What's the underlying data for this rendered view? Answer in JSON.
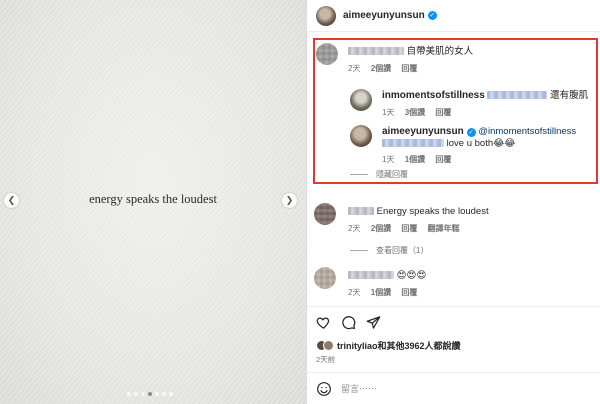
{
  "post": {
    "image_text": "energy speaks the loudest",
    "carousel": {
      "count": 7,
      "active_index": 3
    }
  },
  "header": {
    "username": "aimeeyunyunsun",
    "verified": true
  },
  "comments": [
    {
      "text": "自帶美肌的女人",
      "time": "2天",
      "likes": "2個讚",
      "reply": "回覆",
      "replies": [
        {
          "username": "inmomentsofstillness",
          "text": "還有腹肌",
          "time": "1天",
          "likes": "3個讚",
          "reply": "回覆"
        },
        {
          "username": "aimeeyunyunsun",
          "mention": "@inmomentsofstillness",
          "text": "love u both😂😂",
          "time": "1天",
          "likes": "1個讚",
          "reply": "回覆"
        }
      ],
      "toggle": "隱藏回覆"
    },
    {
      "text": "Energy speaks the loudest",
      "time": "2天",
      "likes": "2個讚",
      "reply": "回覆",
      "translate": "翻譯年糕",
      "toggle": "查看回覆（1）"
    },
    {
      "text": "😍😍😍",
      "time": "2天",
      "likes": "1個讚",
      "reply": "回覆"
    }
  ],
  "footer": {
    "liked_by": "trinityliao和其他3962人都說讚",
    "ago": "2天前",
    "comment_placeholder": "留言⋯⋯"
  },
  "colors": {
    "highlight_border": "#e0392f",
    "verified": "#0095f6",
    "mention": "#00376b",
    "meta_gray": "#737373"
  },
  "icons": [
    "chevron-left-icon",
    "chevron-right-icon",
    "heart-icon",
    "comment-icon",
    "share-icon",
    "emoji-icon",
    "verified-badge-icon"
  ]
}
